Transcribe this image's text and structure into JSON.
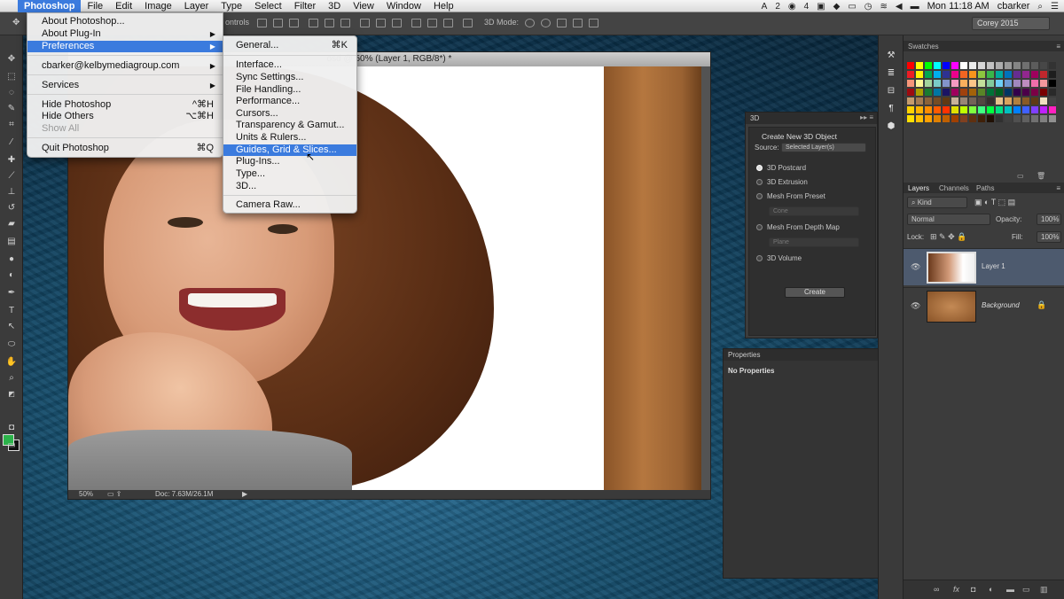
{
  "menubar": {
    "apple": "",
    "items": [
      "Photoshop",
      "File",
      "Edit",
      "Image",
      "Layer",
      "Type",
      "Select",
      "Filter",
      "3D",
      "View",
      "Window",
      "Help"
    ],
    "right": {
      "ai": "2",
      "badge": "4",
      "clock": "Mon 11:18 AM",
      "user": "cbarker"
    }
  },
  "optbar": {
    "controls_label": "ontrols",
    "mode_label": "3D Mode:",
    "workspace": "Corey 2015"
  },
  "docwin": {
    "title": "osd @ 50% (Layer 1, RGB/8*) *",
    "zoom": "50%",
    "doc_info": "Doc: 7.63M/26.1M",
    "arrow": "▶"
  },
  "appmenu": {
    "items": [
      {
        "label": "About Photoshop...",
        "shortcut": "",
        "arrow": ""
      },
      {
        "label": "About Plug-In",
        "shortcut": "",
        "arrow": "▶"
      },
      {
        "label": "Preferences",
        "shortcut": "",
        "arrow": "▶"
      },
      {
        "label": "cbarker@kelbymediagroup.com",
        "shortcut": "",
        "arrow": "▶"
      },
      {
        "label": "Services",
        "shortcut": "",
        "arrow": "▶"
      },
      {
        "label": "Hide Photoshop",
        "shortcut": "^⌘H",
        "arrow": ""
      },
      {
        "label": "Hide Others",
        "shortcut": "⌥⌘H",
        "arrow": ""
      },
      {
        "label": "Show All",
        "shortcut": "",
        "arrow": ""
      },
      {
        "label": "Quit Photoshop",
        "shortcut": "⌘Q",
        "arrow": ""
      }
    ]
  },
  "prefmenu": {
    "items": [
      {
        "label": "General...",
        "shortcut": "⌘K"
      },
      {
        "label": "Interface...",
        "shortcut": ""
      },
      {
        "label": "Sync Settings...",
        "shortcut": ""
      },
      {
        "label": "File Handling...",
        "shortcut": ""
      },
      {
        "label": "Performance...",
        "shortcut": ""
      },
      {
        "label": "Cursors...",
        "shortcut": ""
      },
      {
        "label": "Transparency & Gamut...",
        "shortcut": ""
      },
      {
        "label": "Units & Rulers...",
        "shortcut": ""
      },
      {
        "label": "Guides, Grid & Slices...",
        "shortcut": ""
      },
      {
        "label": "Plug-Ins...",
        "shortcut": ""
      },
      {
        "label": "Type...",
        "shortcut": ""
      },
      {
        "label": "3D...",
        "shortcut": ""
      },
      {
        "label": "Camera Raw...",
        "shortcut": ""
      }
    ]
  },
  "panel3d": {
    "tab": "3D",
    "heading": "Create New 3D Object",
    "source_label": "Source:",
    "source_value": "Selected Layer(s)",
    "options": [
      "3D Postcard",
      "3D Extrusion",
      "Mesh From Preset",
      "Mesh From Depth Map",
      "3D Volume"
    ],
    "preset_value": "Cone",
    "depth_value": "Plane",
    "create_label": "Create"
  },
  "properties": {
    "tab": "Properties",
    "message": "No Properties"
  },
  "swatches": {
    "tab": "Swatches"
  },
  "layers": {
    "tabs": [
      "Layers",
      "Channels",
      "Paths"
    ],
    "filter": "Kind",
    "blend": "Normal",
    "opacity_label": "Opacity:",
    "opacity": "100%",
    "lock_label": "Lock:",
    "fill_label": "Fill:",
    "fill": "100%",
    "rows": [
      {
        "name": "Layer 1"
      },
      {
        "name": "Background"
      }
    ],
    "footer": [
      "∞",
      "fx",
      "◘",
      "◐",
      "▬",
      "▭",
      "▥"
    ]
  },
  "colors": {
    "accent": "#3b7bde",
    "foreground": "#2bb34a",
    "background": "#111111"
  }
}
